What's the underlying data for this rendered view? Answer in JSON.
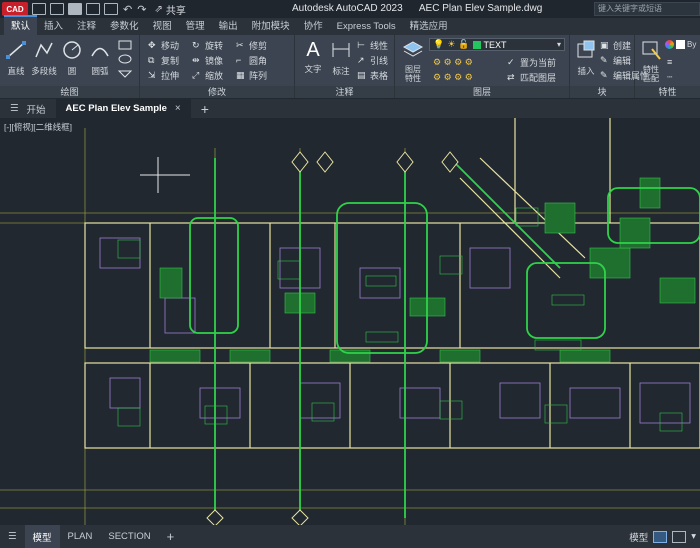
{
  "titlebar": {
    "logo": "CAD",
    "share": "共享",
    "app_title": "Autodesk AutoCAD 2023",
    "file_title": "AEC Plan Elev Sample.dwg",
    "search_placeholder": "键入关键字或短语"
  },
  "ribbon_tabs": [
    "默认",
    "插入",
    "注释",
    "参数化",
    "视图",
    "管理",
    "输出",
    "附加模块",
    "协作",
    "Express Tools",
    "精选应用"
  ],
  "ribbon": {
    "draw": {
      "label": "绘图",
      "line": "直线",
      "polyline": "多段线",
      "circle": "圆",
      "arc": "圆弧"
    },
    "modify": {
      "label": "修改",
      "move": "移动",
      "rotate": "旋转",
      "trim": "修剪",
      "copy": "复制",
      "mirror": "镜像",
      "fillet": "圆角",
      "stretch": "拉伸",
      "scale": "缩放",
      "array": "阵列"
    },
    "annotation": {
      "label": "注释",
      "text": "文字",
      "dimension": "标注",
      "linear": "线性",
      "leader": "引线",
      "table": "表格"
    },
    "layers": {
      "label": "图层",
      "properties": "图层\n特性",
      "layer_name": "TEXT",
      "make_current": "置为当前",
      "match": "匹配图层"
    },
    "block": {
      "label": "块",
      "insert": "插入",
      "create": "创建",
      "edit": "编辑",
      "edit_attr": "编辑属性"
    },
    "properties": {
      "label": "特性",
      "match": "特性\n匹配",
      "bylayer": "By"
    }
  },
  "file_tabs": {
    "start": "开始",
    "active": "AEC Plan Elev Sample",
    "close": "×",
    "add": "+"
  },
  "viewport_label": "[-][俯视][二维线框]",
  "status": {
    "tabs": [
      "模型",
      "PLAN",
      "SECTION"
    ],
    "add": "+",
    "model_label": "模型"
  }
}
